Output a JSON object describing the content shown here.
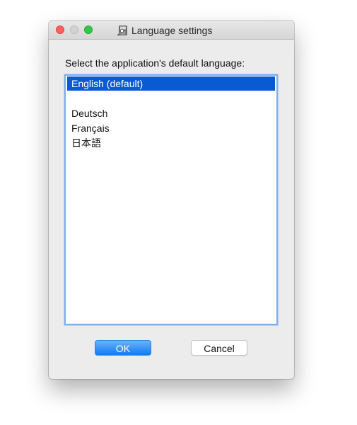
{
  "window": {
    "title": "Language settings",
    "app_icon": "wrench-disk-icon"
  },
  "prompt": "Select the application's default language:",
  "languages": {
    "items": [
      "English (default)",
      "",
      "Deutsch",
      "Français",
      "日本語"
    ],
    "selected_index": 0
  },
  "buttons": {
    "ok_label": "OK",
    "cancel_label": "Cancel"
  },
  "colors": {
    "selection": "#0a5bd3",
    "ok_button": "#0e7cf7",
    "close_light": "#fc605c",
    "zoom_light": "#34c84a"
  }
}
